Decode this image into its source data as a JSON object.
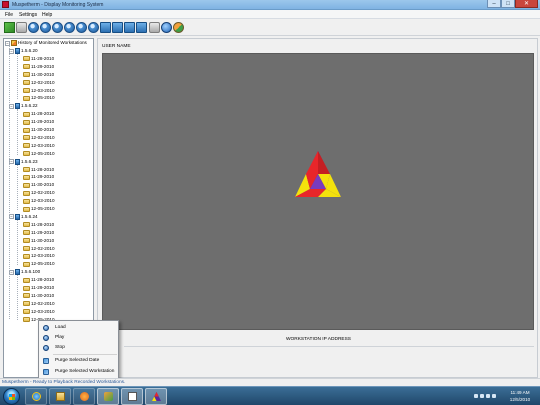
{
  "window": {
    "title": "Muspetherm - Display Monitoring System",
    "minimize_glyph": "–",
    "maximize_glyph": "□",
    "close_glyph": "✕"
  },
  "menu": [
    "File",
    "Settings",
    "Help"
  ],
  "toolbar": {
    "buttons": [
      {
        "name": "connect-icon"
      },
      {
        "name": "disconnect-icon"
      },
      {
        "name": "record-icon-1"
      },
      {
        "name": "record-icon-2"
      },
      {
        "name": "record-icon-3"
      },
      {
        "name": "record-icon-4"
      },
      {
        "name": "record-icon-5"
      },
      {
        "name": "record-icon-6"
      },
      {
        "name": "workstation-icon-1"
      },
      {
        "name": "workstation-icon-2"
      },
      {
        "name": "workstation-icon-3"
      },
      {
        "name": "workstation-icon-4"
      },
      {
        "name": "settings-icon"
      },
      {
        "name": "info-icon"
      },
      {
        "name": "users-icon"
      }
    ]
  },
  "tree": {
    "root_label": "History of Monitored Workstations",
    "workstations": [
      {
        "ip": "1.5.6.20",
        "dates": [
          "11-28-2010",
          "11-29-2010",
          "11-30-2010",
          "12-02-2010",
          "12-03-2010",
          "12-05-2010"
        ]
      },
      {
        "ip": "1.5.6.22",
        "dates": [
          "11-28-2010",
          "11-29-2010",
          "11-30-2010",
          "12-02-2010",
          "12-03-2010",
          "12-05-2010"
        ]
      },
      {
        "ip": "1.5.6.23",
        "dates": [
          "11-28-2010",
          "11-29-2010",
          "11-30-2010",
          "12-02-2010",
          "12-03-2010",
          "12-05-2010"
        ]
      },
      {
        "ip": "1.5.6.24",
        "dates": [
          "11-28-2010",
          "11-29-2010",
          "11-30-2010",
          "12-02-2010",
          "12-03-2010",
          "12-05-2010"
        ]
      },
      {
        "ip": "1.5.6.100",
        "dates": [
          "11-28-2010",
          "11-29-2010",
          "11-30-2010",
          "12-02-2010",
          "12-03-2010",
          "12-05-2010"
        ]
      }
    ]
  },
  "viewer": {
    "user_name_label": "USER NAME",
    "ip_label": "WORKSTATION IP ADDRESS"
  },
  "context_menu": {
    "items": [
      "Load",
      "Play",
      "Stop"
    ],
    "purge_items": [
      "Purge Selected Date",
      "Purge Selected Workstation"
    ]
  },
  "status": "Muspetherm - Ready to Playback Recorded Workstations.",
  "clock": {
    "time": "11:49 AM",
    "date": "12/5/2010"
  },
  "colors": {
    "screen_bg": "#6e6e6e",
    "logo_red": "#e8262a",
    "logo_yellow": "#f4e20c",
    "logo_purple": "#5a2a9c",
    "taskbar": "#2b5a80"
  }
}
